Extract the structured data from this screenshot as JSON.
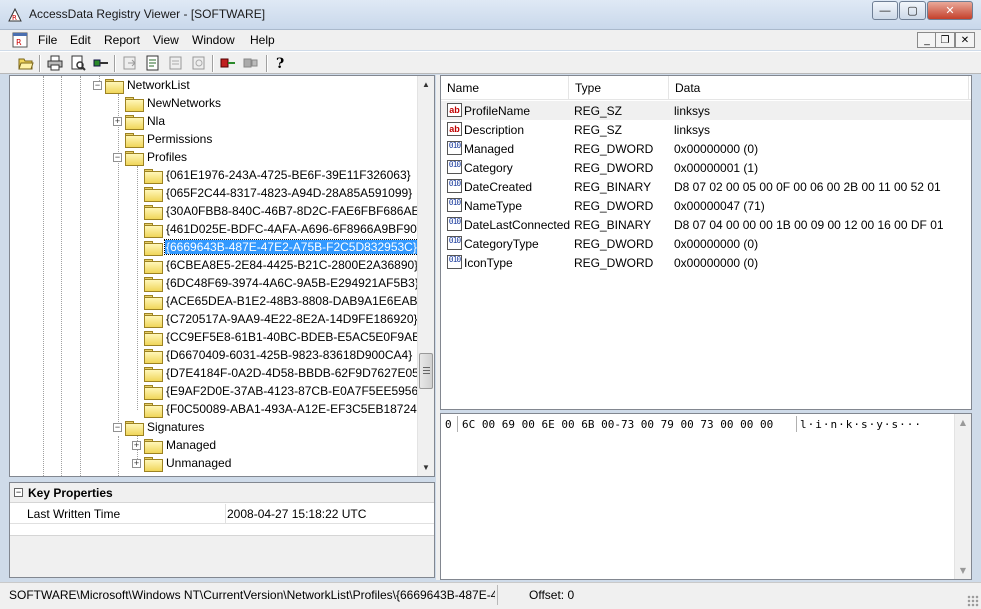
{
  "window": {
    "title": "AccessData Registry Viewer - [SOFTWARE]",
    "minimize_glyph": "—",
    "maximize_glyph": "▢",
    "close_glyph": "✕"
  },
  "menu": {
    "items": [
      "File",
      "Edit",
      "Report",
      "View",
      "Window",
      "Help"
    ],
    "mdi_minimize": "_",
    "mdi_restore": "❐",
    "mdi_close": "✕"
  },
  "toolbar": {
    "icons": [
      "open-folder-icon",
      "print-icon",
      "print-preview-icon",
      "connect-icon",
      "export-icon",
      "report-icon",
      "find-icon",
      "find-next-icon",
      "plug-connect-icon",
      "plug-disconnect-icon",
      "help-icon"
    ]
  },
  "tree": {
    "nodes": [
      {
        "label": "NetworkList",
        "expander": "−"
      },
      {
        "label": "NewNetworks",
        "expander": ""
      },
      {
        "label": "Nla",
        "expander": "+"
      },
      {
        "label": "Permissions",
        "expander": ""
      },
      {
        "label": "Profiles",
        "expander": "−"
      },
      {
        "label": "{061E1976-243A-4725-BE6F-39E11F326063}",
        "expander": ""
      },
      {
        "label": "{065F2C44-8317-4823-A94D-28A85A591099}",
        "expander": ""
      },
      {
        "label": "{30A0FBB8-840C-46B7-8D2C-FAE6FBF686AE}",
        "expander": ""
      },
      {
        "label": "{461D025E-BDFC-4AFA-A696-6F8966A9BF90}",
        "expander": ""
      },
      {
        "label": "{6669643B-487E-47E2-A75B-F2C5D832953C}",
        "expander": "",
        "selected": true
      },
      {
        "label": "{6CBEA8E5-2E84-4425-B21C-2800E2A36890}",
        "expander": ""
      },
      {
        "label": "{6DC48F69-3974-4A6C-9A5B-E294921AF5B3}",
        "expander": ""
      },
      {
        "label": "{ACE65DEA-B1E2-48B3-8808-DAB9A1E6EAB3}",
        "expander": ""
      },
      {
        "label": "{C720517A-9AA9-4E22-8E2A-14D9FE186920}",
        "expander": ""
      },
      {
        "label": "{CC9EF5E8-61B1-40BC-BDEB-E5AC5E0F9ABA}",
        "expander": ""
      },
      {
        "label": "{D6670409-6031-425B-9823-83618D900CA4}",
        "expander": ""
      },
      {
        "label": "{D7E4184F-0A2D-4D58-BBDB-62F9D7627E05}",
        "expander": ""
      },
      {
        "label": "{E9AF2D0E-37AB-4123-87CB-E0A7F5EE5956}",
        "expander": ""
      },
      {
        "label": "{F0C50089-ABA1-493A-A12E-EF3C5EB18724}",
        "expander": ""
      },
      {
        "label": "Signatures",
        "expander": "−"
      },
      {
        "label": "Managed",
        "expander": "+"
      },
      {
        "label": "Unmanaged",
        "expander": "+"
      }
    ]
  },
  "key_properties": {
    "title": "Key Properties",
    "collapse_glyph": "−",
    "rows": [
      {
        "name": "Last Written Time",
        "value": "2008-04-27 15:18:22 UTC"
      }
    ]
  },
  "values_list": {
    "columns": [
      "Name",
      "Type",
      "Data"
    ],
    "rows": [
      {
        "icon": "ab",
        "name": "ProfileName",
        "type": "REG_SZ",
        "data": "linksys"
      },
      {
        "icon": "ab",
        "name": "Description",
        "type": "REG_SZ",
        "data": "linksys"
      },
      {
        "icon": "010",
        "name": "Managed",
        "type": "REG_DWORD",
        "data": "0x00000000 (0)"
      },
      {
        "icon": "010",
        "name": "Category",
        "type": "REG_DWORD",
        "data": "0x00000001 (1)"
      },
      {
        "icon": "010",
        "name": "DateCreated",
        "type": "REG_BINARY",
        "data": "D8 07 02 00 05 00 0F 00 06 00 2B 00 11 00 52 01"
      },
      {
        "icon": "010",
        "name": "NameType",
        "type": "REG_DWORD",
        "data": "0x00000047 (71)"
      },
      {
        "icon": "010",
        "name": "DateLastConnected",
        "type": "REG_BINARY",
        "data": "D8 07 04 00 00 00 1B 00 09 00 12 00 16 00 DF 01"
      },
      {
        "icon": "010",
        "name": "CategoryType",
        "type": "REG_DWORD",
        "data": "0x00000000 (0)"
      },
      {
        "icon": "010",
        "name": "IconType",
        "type": "REG_DWORD",
        "data": "0x00000000 (0)"
      }
    ]
  },
  "hex_view": {
    "offset": "0",
    "bytes": "6C 00 69 00 6E 00 6B 00-73 00 79 00 73 00 00 00",
    "ascii": "l·i·n·k·s·y·s···"
  },
  "status": {
    "path": "SOFTWARE\\Microsoft\\Windows NT\\CurrentVersion\\NetworkList\\Profiles\\{6669643B-487E-47",
    "offset": "Offset: 0"
  }
}
